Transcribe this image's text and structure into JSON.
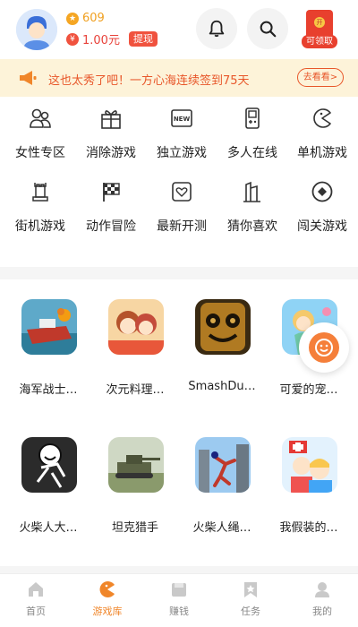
{
  "header": {
    "coins": "609",
    "coin_icon_glyph": "★",
    "money_prefix": "¥",
    "money": "1.00元",
    "withdraw_label": "提现",
    "redpacket_seal": "开",
    "redpacket_label": "可领取",
    "icons": [
      "avatar",
      "bell-icon",
      "search-icon",
      "red-packet-icon"
    ]
  },
  "notice": {
    "text": "这也太秀了吧！一方心海连续签到75天",
    "button_label": "去看看>",
    "icon": "megaphone-icon"
  },
  "categories": [
    {
      "label": "女性专区",
      "icon": "female-users-icon"
    },
    {
      "label": "消除游戏",
      "icon": "gift-box-icon"
    },
    {
      "label": "独立游戏",
      "icon": "new-badge-icon"
    },
    {
      "label": "多人在线",
      "icon": "gameboy-icon"
    },
    {
      "label": "单机游戏",
      "icon": "pacman-icon"
    },
    {
      "label": "街机游戏",
      "icon": "arcade-tower-icon"
    },
    {
      "label": "动作冒险",
      "icon": "checkered-flag-icon"
    },
    {
      "label": "最新开测",
      "icon": "heart-card-icon"
    },
    {
      "label": "猜你喜欢",
      "icon": "building-icon"
    },
    {
      "label": "闯关游戏",
      "icon": "target-icon"
    }
  ],
  "games": [
    {
      "title": "海军战士…",
      "thumb": "warship"
    },
    {
      "title": "次元料理…",
      "thumb": "anime-chef"
    },
    {
      "title": "SmashDu…",
      "thumb": "wooden-face"
    },
    {
      "title": "可爱的宠…",
      "thumb": "mermaid-princess"
    },
    {
      "title": "火柴人大…",
      "thumb": "stickman"
    },
    {
      "title": "坦克猎手",
      "thumb": "tank"
    },
    {
      "title": "火柴人绳…",
      "thumb": "rope-hero"
    },
    {
      "title": "我假装的…",
      "thumb": "doctor-kids"
    }
  ],
  "tabs": [
    {
      "label": "首页",
      "icon": "home-icon",
      "active": false
    },
    {
      "label": "游戏库",
      "icon": "pacman-icon",
      "active": true
    },
    {
      "label": "赚钱",
      "icon": "wallet-icon",
      "active": false
    },
    {
      "label": "任务",
      "icon": "task-flag-icon",
      "active": false
    },
    {
      "label": "我的",
      "icon": "profile-icon",
      "active": false
    }
  ],
  "colors": {
    "accent": "#f0862a",
    "notice_bg": "#fdf3d9",
    "notice_text": "#e8572a",
    "money_red": "#f0523e",
    "coin_gold": "#f5a623"
  }
}
